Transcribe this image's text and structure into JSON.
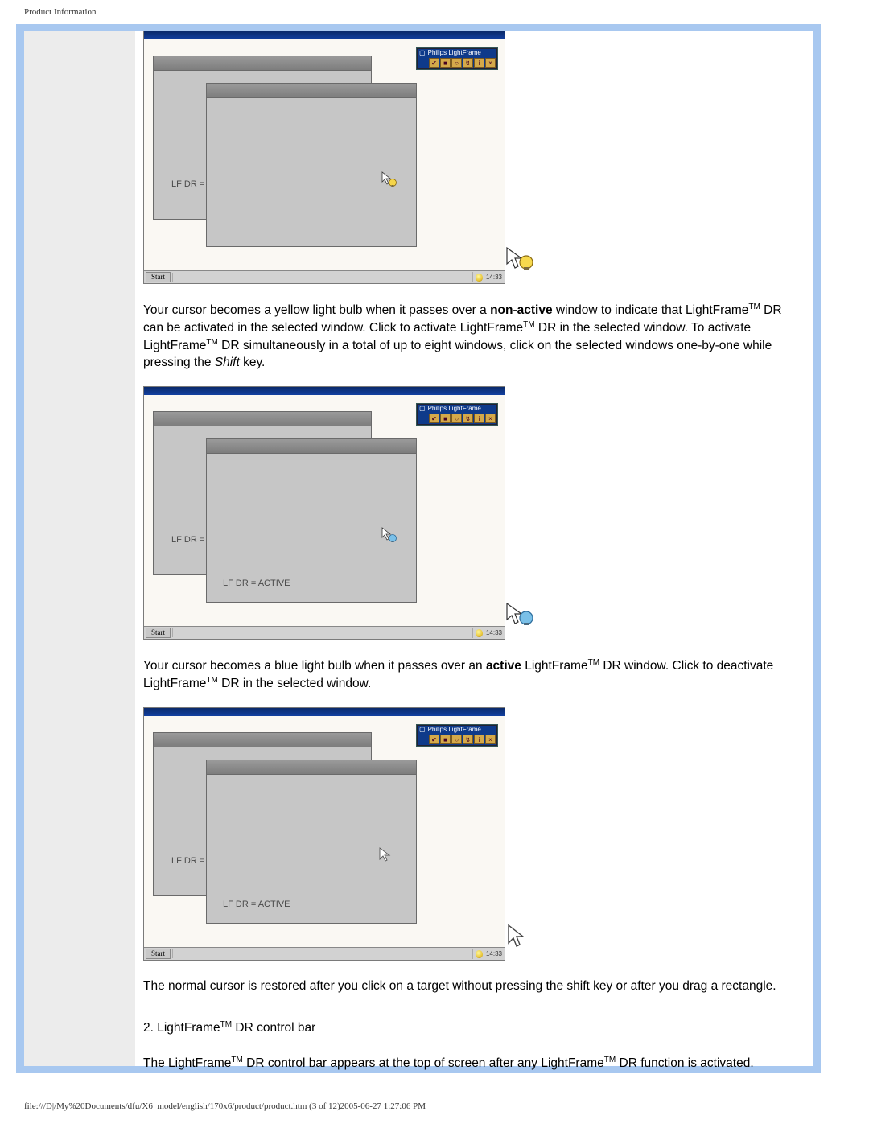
{
  "header": "Product Information",
  "footer": "file:///D|/My%20Documents/dfu/X6_model/english/170x6/product/product.htm (3 of 12)2005-06-27 1:27:06 PM",
  "para1": {
    "pre": "Your cursor becomes a yellow light bulb when it passes over a ",
    "bold1": "non-active",
    "mid1": " window to indicate that LightFrame",
    "tm1": "TM",
    "mid2": " DR can be activated in the selected window. Click to activate LightFrame",
    "tm2": "TM",
    "mid3": " DR in the selected window. To activate LightFrame",
    "tm3": "TM",
    "mid4": " DR simultaneously in a total of up to eight windows, click on the selected windows one-by-one while pressing the ",
    "italic": "Shift",
    "end": " key."
  },
  "para2": {
    "pre": "Your cursor becomes a blue light bulb when it passes over an ",
    "bold1": "active",
    "mid1": " LightFrame",
    "tm1": "TM",
    "mid2": " DR window. Click to deactivate LightFrame",
    "tm2": "TM",
    "end": " DR in the selected window."
  },
  "para3": "The normal cursor is restored after you click on a target without pressing the shift key or after you drag a rectangle.",
  "para4": {
    "pre": "2. LightFrame",
    "tm": "TM",
    "end": " DR control bar"
  },
  "para5": {
    "pre": "The LightFrame",
    "tm1": "TM",
    "mid": " DR control bar appears at the top of screen after any LightFrame",
    "tm2": "TM",
    "end": " DR function is activated."
  },
  "shot": {
    "controlbar_title": "Philips LightFrame",
    "win_back_label": "LF DR =",
    "win_front_label_active": "LF DR = ACTIVE",
    "taskbar_start": "Start",
    "taskbar_time": "14:33"
  }
}
